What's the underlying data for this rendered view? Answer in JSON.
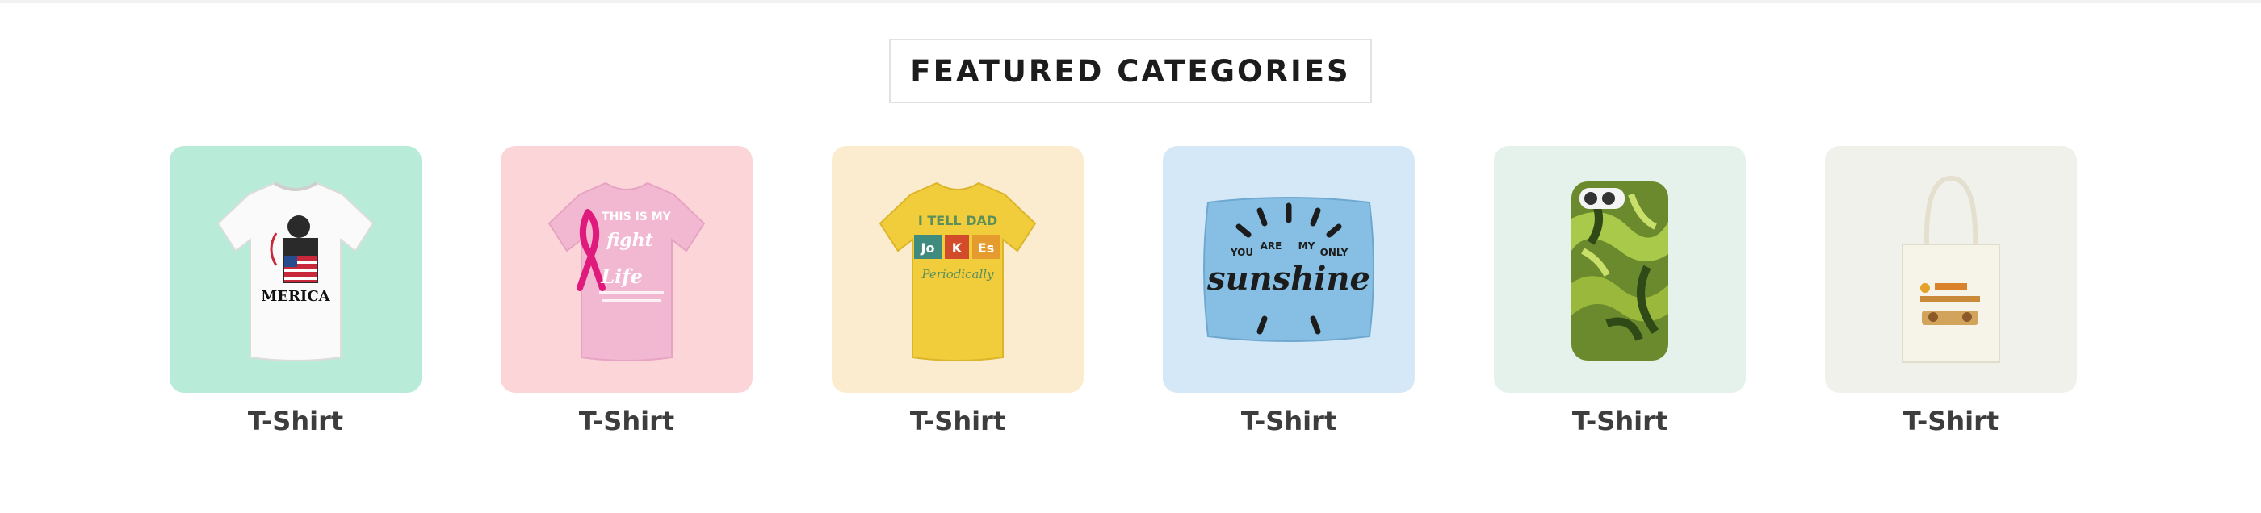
{
  "section": {
    "title": "FEATURED CATEGORIES"
  },
  "categories": [
    {
      "label": "T-Shirt",
      "bg": "#b8ecd8",
      "print_text": "MERICA"
    },
    {
      "label": "T-Shirt",
      "bg": "#fcd5d9",
      "print_lines": [
        "THIS IS MY",
        "fight",
        "Life"
      ]
    },
    {
      "label": "T-Shirt",
      "bg": "#fbeccf",
      "print_lines": [
        "I TELL DAD",
        "Jo",
        "K",
        "Es",
        "Periodically"
      ]
    },
    {
      "label": "T-Shirt",
      "bg": "#d5e8f7",
      "print_lines": [
        "YOU",
        "ARE",
        "MY",
        "ONLY",
        "sunshine"
      ]
    },
    {
      "label": "T-Shirt",
      "bg": "#e5f2ec"
    },
    {
      "label": "T-Shirt",
      "bg": "#f1f1ec"
    }
  ]
}
